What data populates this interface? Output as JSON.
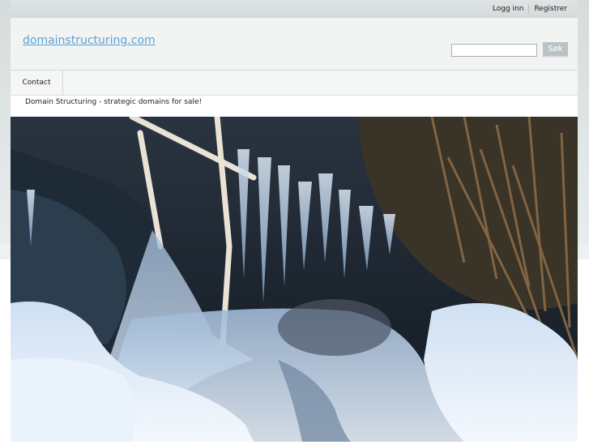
{
  "topbar": {
    "login_label": "Logg inn",
    "register_label": "Registrer"
  },
  "header": {
    "site_title": "domainstructuring.com",
    "search": {
      "value": "",
      "placeholder": "",
      "button_label": "Søk"
    }
  },
  "nav": {
    "items": [
      {
        "label": "Contact"
      }
    ]
  },
  "tagline": "Domain Structuring - strategic domains for sale!",
  "hero": {
    "icon": "frozen-waterfall-photo"
  }
}
